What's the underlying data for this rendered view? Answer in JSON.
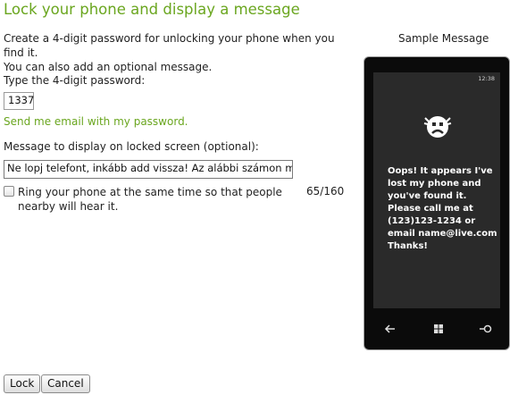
{
  "page": {
    "title": "Lock your phone and display a message",
    "intro_line1": "Create a 4-digit password for unlocking your phone when you find it.",
    "intro_line2": "You can also add an optional message."
  },
  "password": {
    "label": "Type the 4-digit password:",
    "value": "1337"
  },
  "email_link": "Send me email with my password.",
  "message": {
    "label": "Message to display on locked screen (optional):",
    "value": "Ne lopj telefont, inkább add vissza! Az alábbi számon megt",
    "counter": "65/160"
  },
  "ring": {
    "label": "Ring your phone at the same time so that people nearby will hear it.",
    "checked": false
  },
  "sample": {
    "title": "Sample Message",
    "clock": "12:38",
    "message": "Oops! It appears I've lost my phone and you've found it. Please call me at (123)123-1234 or email name@live.com Thanks!"
  },
  "buttons": {
    "lock": "Lock",
    "cancel": "Cancel"
  },
  "colors": {
    "accent": "#6aa61f",
    "phone_screen": "#2a2a2a",
    "phone_body": "#0b0b0b"
  }
}
